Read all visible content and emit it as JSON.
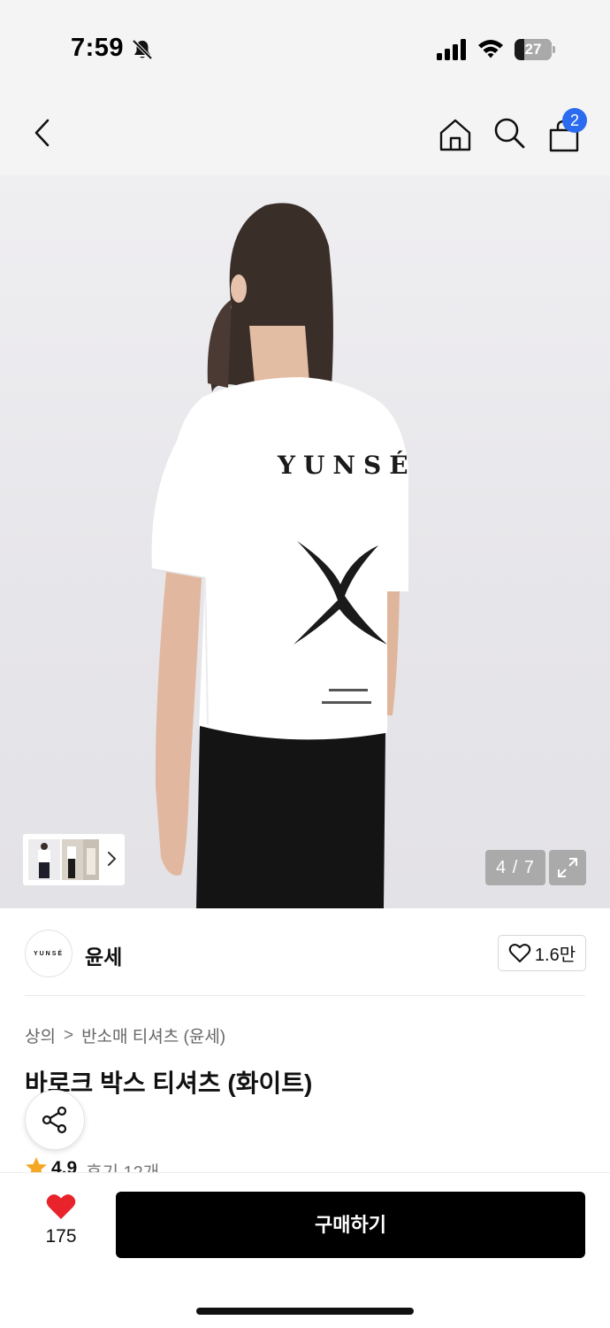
{
  "status_bar": {
    "time": "7:59",
    "battery_level": "27",
    "icons": [
      "bell-slash-icon",
      "signal-icon",
      "wifi-icon",
      "battery-icon"
    ]
  },
  "nav": {
    "icons": [
      "back-chevron-icon",
      "home-icon",
      "search-icon",
      "shopping-bag-icon"
    ],
    "cart_badge": "2"
  },
  "gallery": {
    "counter": "4 / 7",
    "expand_icon": "expand-icon"
  },
  "brand": {
    "logo_text": "YUNSÉ",
    "name": "윤세",
    "like_count": "1.6만"
  },
  "breadcrumb": {
    "category": "상의",
    "separator": ">",
    "subcategory": "반소매 티셔츠 (윤세)"
  },
  "product": {
    "title": "바로크 박스 티셔츠 (화이트)",
    "rating": "4.9",
    "reviews": "후기 12개",
    "print_brand": "YUNSÉ"
  },
  "bottom_bar": {
    "wish_count": "175",
    "buy_label": "구매하기"
  },
  "colors": {
    "accent_badge": "#2b6bf0",
    "heart": "#e8232c",
    "buy_button": "#000000",
    "star": "#f5a623"
  }
}
